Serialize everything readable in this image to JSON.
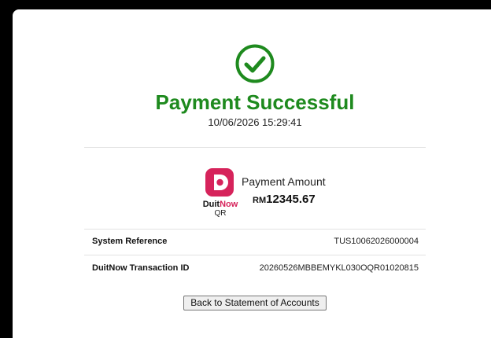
{
  "status": {
    "icon": "check-circle-icon",
    "title": "Payment Successful",
    "timestamp": "10/06/2026 15:29:41",
    "color": "#1e8a1e"
  },
  "payment": {
    "logo": {
      "icon": "duitnow-logo-icon",
      "name_part1": "Duit",
      "name_part2": "Now",
      "sub": "QR",
      "brand_color": "#d6235b"
    },
    "amount_label": "Payment Amount",
    "currency": "RM",
    "amount": "12345.67"
  },
  "details": [
    {
      "label": "System Reference",
      "value": "TUS10062026000004"
    },
    {
      "label": "DuitNow Transaction ID",
      "value": "20260526MBBEMYKL030OQR01020815"
    }
  ],
  "actions": {
    "back_label": "Back to Statement of Accounts"
  }
}
